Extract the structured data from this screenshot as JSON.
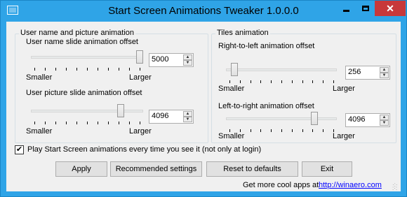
{
  "window": {
    "title": "Start Screen Animations Tweaker 1.0.0.0",
    "close_glyph": "✕"
  },
  "user_group": {
    "title": "User name and picture animation",
    "name_slider": {
      "label": "User name slide animation offset",
      "min_label": "Smaller",
      "max_label": "Larger",
      "value": "5000",
      "position_fraction": 1.0
    },
    "picture_slider": {
      "label": "User picture slide animation offset",
      "min_label": "Smaller",
      "max_label": "Larger",
      "value": "4096",
      "position_fraction": 0.82
    }
  },
  "tiles_group": {
    "title": "Tiles animation",
    "rtl_slider": {
      "label": "Right-to-left animation offset",
      "min_label": "Smaller",
      "max_label": "Larger",
      "value": "256",
      "position_fraction": 0.05
    },
    "ltr_slider": {
      "label": "Left-to-right animation offset",
      "min_label": "Smaller",
      "max_label": "Larger",
      "value": "4096",
      "position_fraction": 0.82
    }
  },
  "play_always": {
    "checked": true,
    "check_glyph": "✔",
    "label": "Play Start Screen animations every time you see it (not only at login)"
  },
  "buttons": {
    "apply": "Apply",
    "recommended": "Recommended settings",
    "reset": "Reset to defaults",
    "exit": "Exit"
  },
  "footer": {
    "text": "Get more cool apps at",
    "link": "http://winaero.com"
  },
  "spin_glyphs": {
    "up": "▲",
    "down": "▼"
  }
}
